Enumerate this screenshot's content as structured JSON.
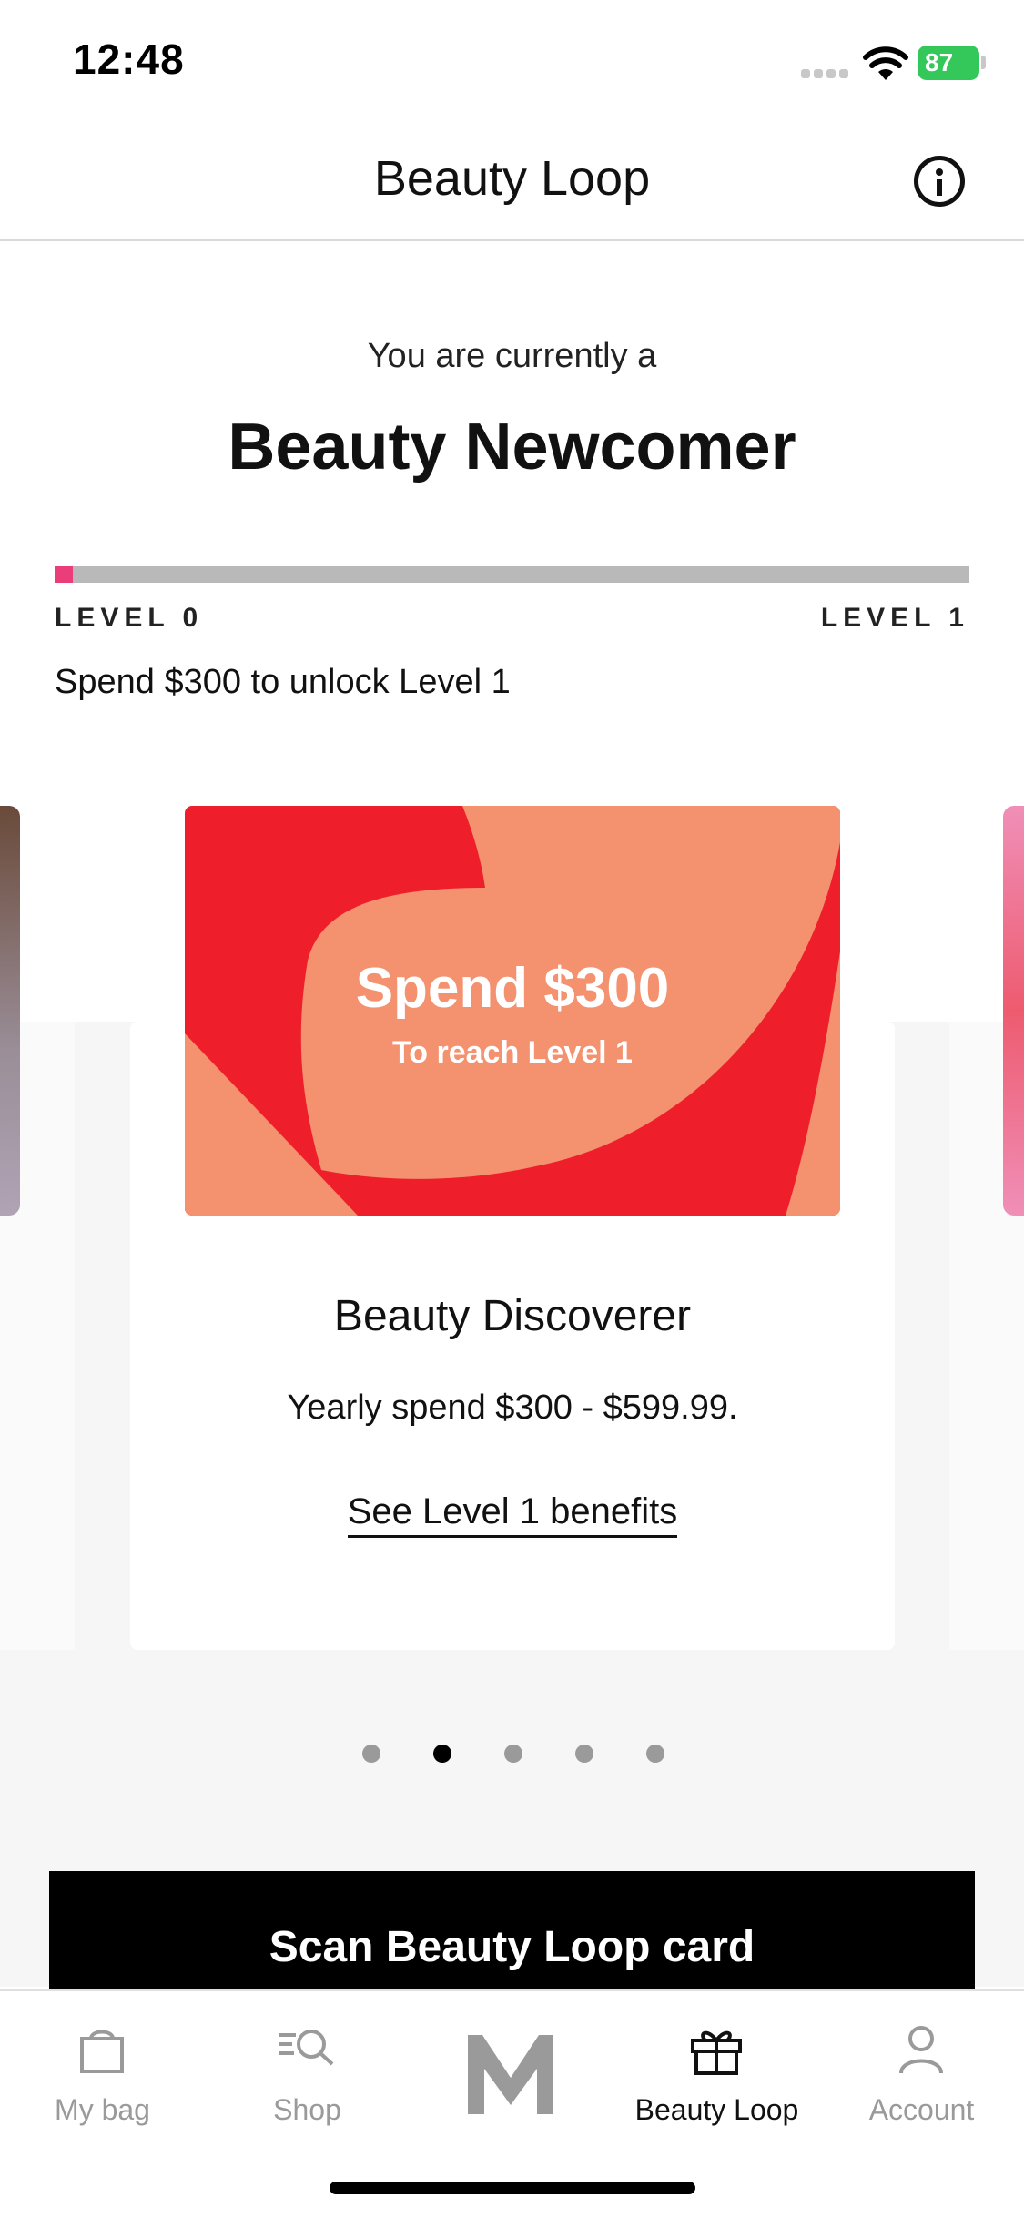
{
  "status_bar": {
    "time": "12:48",
    "battery": "87"
  },
  "header": {
    "title": "Beauty Loop"
  },
  "status": {
    "label": "You are currently a",
    "tier": "Beauty Newcomer"
  },
  "progress": {
    "fraction": 0.02,
    "fill_color": "#ea3d7a",
    "left_label": "LEVEL 0",
    "right_label": "LEVEL 1",
    "message": "Spend $300 to unlock Level 1"
  },
  "card": {
    "banner_title": "Spend $300",
    "banner_subtitle": "To reach Level 1",
    "title": "Beauty Discoverer",
    "description": "Yearly spend $300 - $599.99.",
    "link": "See Level 1 benefits",
    "colors": {
      "red": "#ee1f2b",
      "peach": "#f4916f"
    }
  },
  "pagination": {
    "count": 5,
    "active": 1
  },
  "scan_button": "Scan Beauty Loop card",
  "tabs": [
    {
      "label": "My bag",
      "icon": "bag-icon",
      "active": false
    },
    {
      "label": "Shop",
      "icon": "search-icon",
      "active": false
    },
    {
      "label": "",
      "icon": "m-logo-icon",
      "active": false
    },
    {
      "label": "Beauty Loop",
      "icon": "gift-icon",
      "active": true
    },
    {
      "label": "Account",
      "icon": "person-icon",
      "active": false
    }
  ]
}
